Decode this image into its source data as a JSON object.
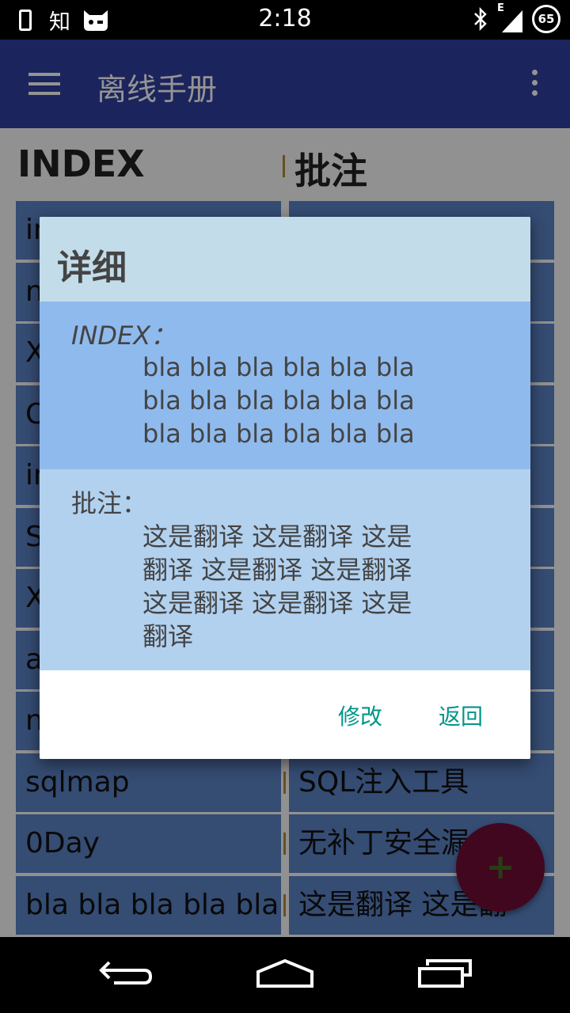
{
  "status_bar": {
    "app_icon_label": "知",
    "time": "2:18",
    "network": "E",
    "battery": "65"
  },
  "app_bar": {
    "title": "离线手册"
  },
  "table": {
    "headers": [
      "INDEX",
      "批注"
    ],
    "rows": [
      {
        "index": "in",
        "note": ""
      },
      {
        "index": "n",
        "note": ""
      },
      {
        "index": "X",
        "note": ""
      },
      {
        "index": "O",
        "note": ""
      },
      {
        "index": "in",
        "note": ""
      },
      {
        "index": "S",
        "note": ""
      },
      {
        "index": "X",
        "note": ""
      },
      {
        "index": "a",
        "note": ""
      },
      {
        "index": "n",
        "note": ""
      },
      {
        "index": "sqlmap",
        "note": "SQL注入工具"
      },
      {
        "index": "0Day",
        "note": "无补丁安全漏"
      },
      {
        "index": "bla bla bla bla bla",
        "note": "这是翻译 这是翻"
      }
    ]
  },
  "dialog": {
    "title": "详细",
    "index_label": "INDEX：",
    "index_value": "bla bla bla bla bla bla bla bla bla bla bla bla bla bla bla bla bla bla",
    "note_label": "批注：",
    "note_value": "这是翻译 这是翻译 这是翻译 这是翻译 这是翻译 这是翻译 这是翻译 这是翻译",
    "edit_button": "修改",
    "back_button": "返回"
  },
  "fab": {
    "label": "+"
  },
  "colors": {
    "app_bar": "#303f9f",
    "cell": "#5c84c6",
    "accent_fab": "#c2185b",
    "dialog_button": "#009688"
  }
}
